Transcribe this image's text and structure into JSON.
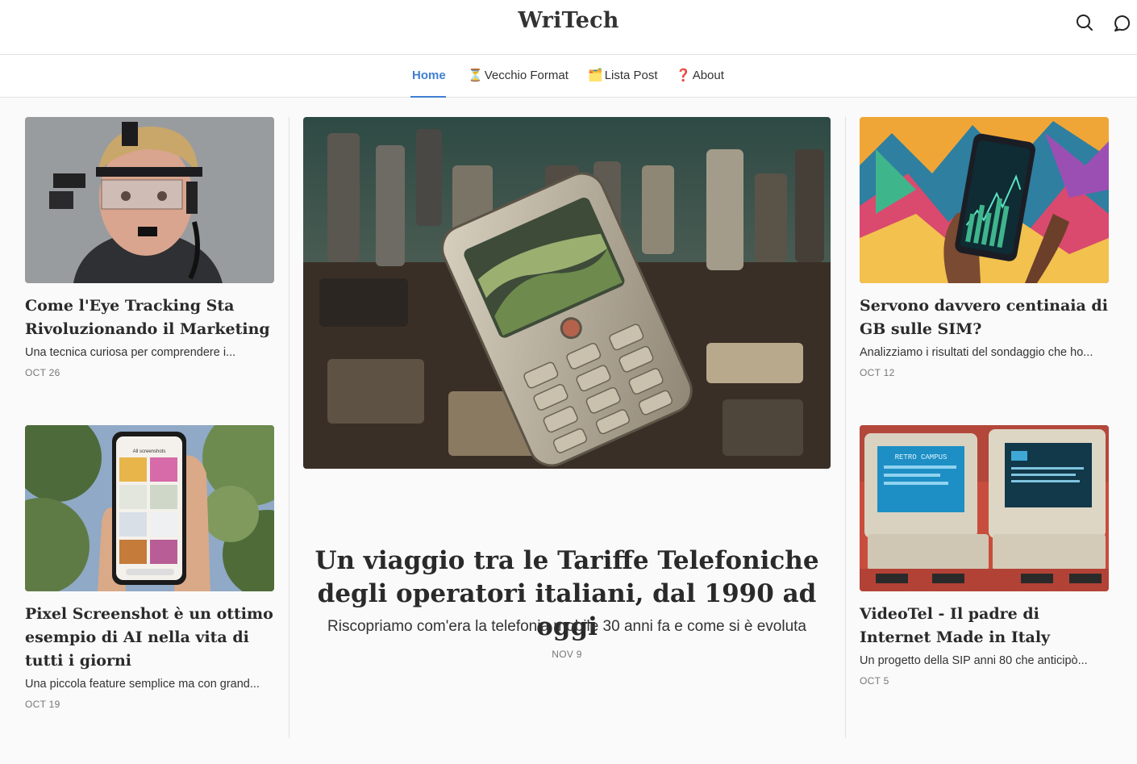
{
  "site": {
    "title": "WriTech"
  },
  "header_icons": [
    {
      "icon": "search-icon"
    },
    {
      "icon": "comment-icon"
    }
  ],
  "nav": {
    "items": [
      {
        "emoji": "",
        "label": "Home",
        "active": true
      },
      {
        "emoji": "⏳",
        "label": "Vecchio Format",
        "active": false
      },
      {
        "emoji": "🗂️",
        "label": "Lista Post",
        "active": false
      },
      {
        "emoji": "❓",
        "label": "About",
        "active": false
      }
    ]
  },
  "featured": {
    "title": "Un viaggio tra le Tariffe Telefoniche degli operatori italiani, dal 1990 ad oggi",
    "excerpt": "Riscopriamo com'era la telefonia mobile 30 anni fa e come si è evoluta",
    "date": "NOV 9"
  },
  "posts_left": [
    {
      "title": "Come l'Eye Tracking Sta Rivoluzionando il Marketing",
      "excerpt": "Una tecnica curiosa per comprendere i...",
      "date": "OCT 26"
    },
    {
      "title": "Pixel Screenshot è un ottimo esempio di AI nella vita di tutti i giorni",
      "excerpt": "Una piccola feature semplice ma con grand...",
      "date": "OCT 19"
    }
  ],
  "posts_right": [
    {
      "title": "Servono davvero centinaia di GB sulle SIM?",
      "excerpt": "Analizziamo i risultati del sondaggio che ho...",
      "date": "OCT 12"
    },
    {
      "title": "VideoTel - Il padre di Internet Made in Italy",
      "excerpt": "Un progetto della SIP anni 80 che anticipò...",
      "date": "OCT 5"
    }
  ],
  "image_text": {
    "phone_screen_title": "All screenshots",
    "terminal_left": "RETRO CAMPUS"
  },
  "colors": {
    "accent": "#3f7fd3",
    "text": "#2a2a2a",
    "background": "#fafafa"
  }
}
